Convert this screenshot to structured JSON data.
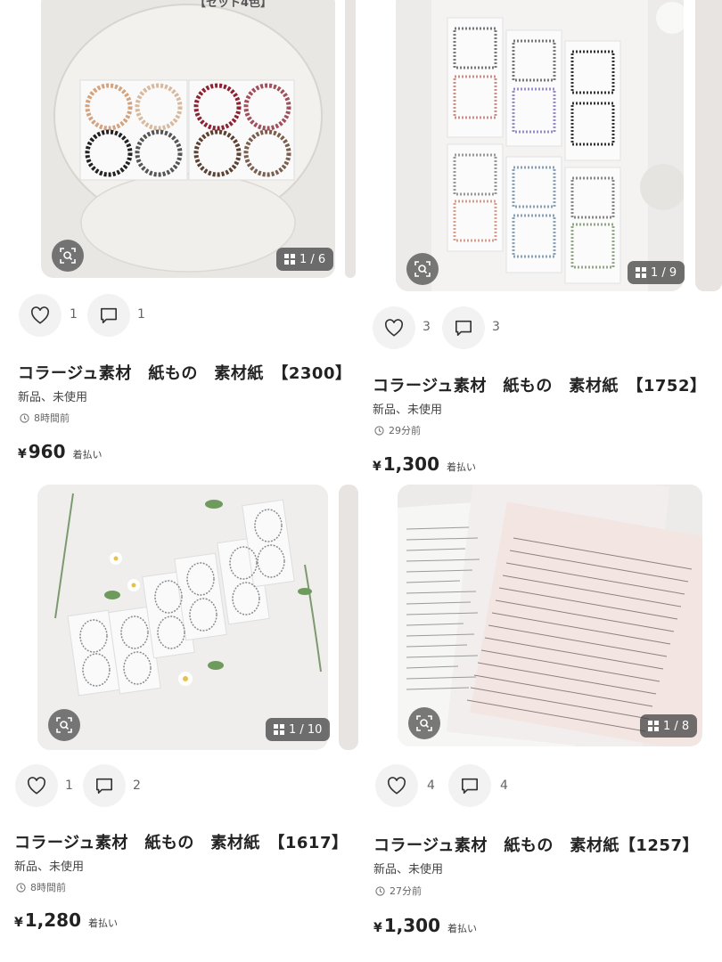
{
  "items": [
    {
      "image_alt": "【セット4色】",
      "image_counter": "1 / 6",
      "likes": "1",
      "comments": "1",
      "title": "コラージュ素材　紙もの　素材紙　【2300】",
      "condition": "新品、未使用",
      "posted": "8時間前",
      "currency": "¥",
      "price": "960",
      "shipping": "着払い"
    },
    {
      "image_counter": "1 / 9",
      "likes": "3",
      "comments": "3",
      "title": "コラージュ素材　紙もの　素材紙　【1752】",
      "condition": "新品、未使用",
      "posted": "29分前",
      "currency": "¥",
      "price": "1,300",
      "shipping": "着払い"
    },
    {
      "image_counter": "1 / 10",
      "likes": "1",
      "comments": "2",
      "title": "コラージュ素材　紙もの　素材紙　【1617】",
      "condition": "新品、未使用",
      "posted": "8時間前",
      "currency": "¥",
      "price": "1,280",
      "shipping": "着払い"
    },
    {
      "image_counter": "1 / 8",
      "likes": "4",
      "comments": "4",
      "title": "コラージュ素材　紙もの　素材紙【1257】",
      "condition": "新品、未使用",
      "posted": "27分前",
      "currency": "¥",
      "price": "1,300",
      "shipping": "着払い"
    }
  ],
  "icons": {
    "lens": "image-search-icon",
    "grid": "grid-icon",
    "like": "heart-icon",
    "comment": "comment-icon",
    "clock": "clock-icon"
  },
  "colors": {
    "action_bg": "#f2f2f2",
    "overlay": "#464646",
    "text": "#222222",
    "muted": "#666666"
  }
}
